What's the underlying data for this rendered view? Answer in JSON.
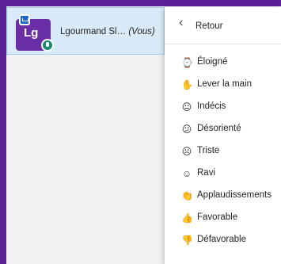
{
  "user": {
    "initials": "Lg",
    "name": "Lgourmand Sl…",
    "suffix": "(Vous)"
  },
  "menu": {
    "back_label": "Retour",
    "items": [
      {
        "label": "Éloigné",
        "icon": "clock-icon",
        "glyph": "⌚"
      },
      {
        "label": "Lever la main",
        "icon": "raised-hand-icon",
        "glyph": "✋"
      },
      {
        "label": "Indécis",
        "icon": "neutral-face-icon",
        "glyph": "😐"
      },
      {
        "label": "Désorienté",
        "icon": "confused-face-icon",
        "glyph": "😕"
      },
      {
        "label": "Triste",
        "icon": "sad-face-icon",
        "glyph": "☹"
      },
      {
        "label": "Ravi",
        "icon": "happy-face-icon",
        "glyph": "☺"
      },
      {
        "label": "Applaudissements",
        "icon": "clapping-hands-icon",
        "glyph": "👏"
      },
      {
        "label": "Favorable",
        "icon": "thumbs-up-icon",
        "glyph": "👍"
      },
      {
        "label": "Défavorable",
        "icon": "thumbs-down-icon",
        "glyph": "👎"
      }
    ]
  },
  "colors": {
    "frame": "#5b1f96",
    "avatar": "#6a2ea6",
    "selected_row": "#d9ebf8",
    "status_blue": "#1f66c9",
    "mic_green": "#1b8a73"
  }
}
